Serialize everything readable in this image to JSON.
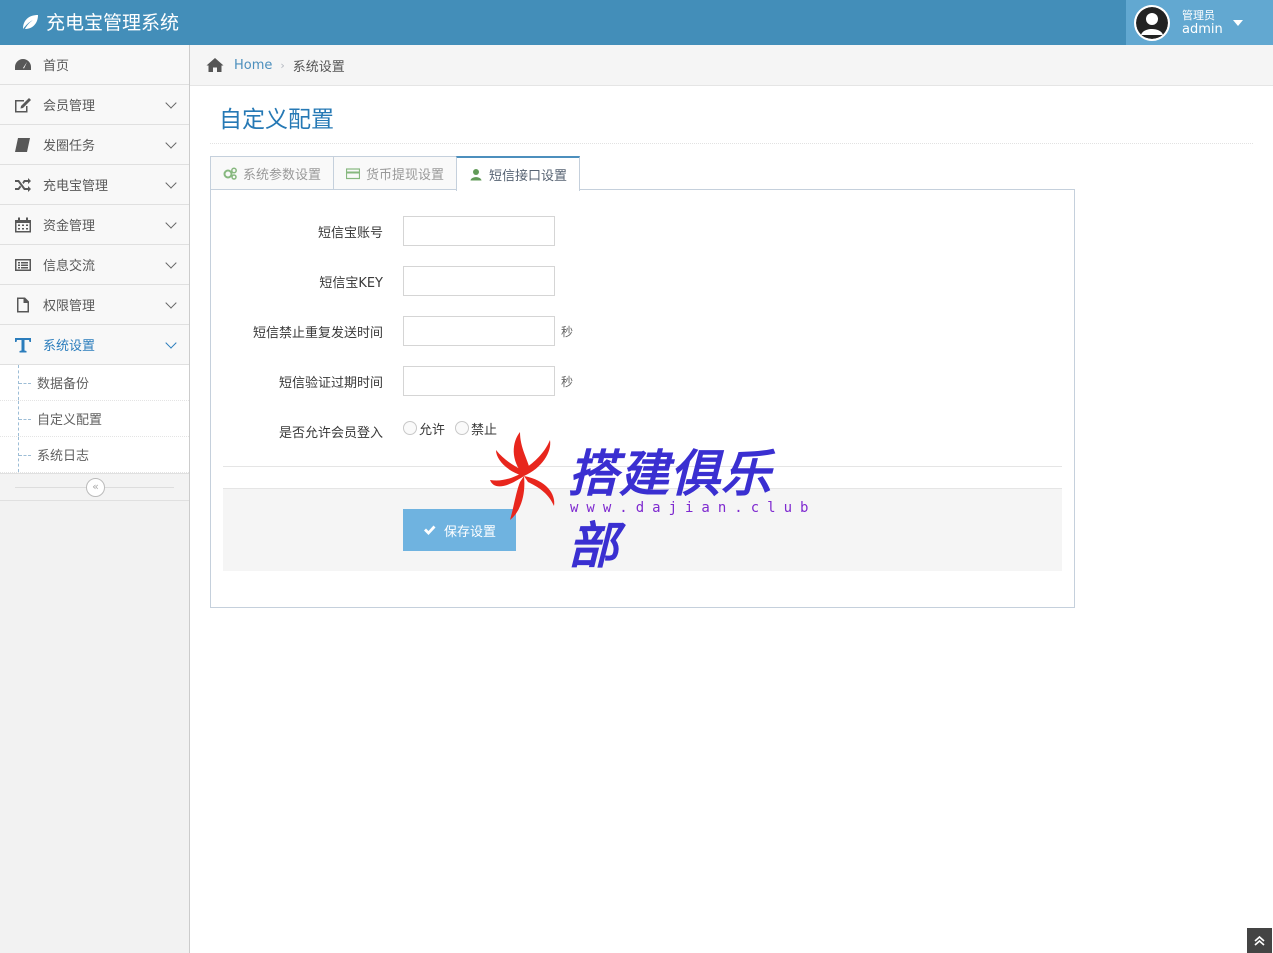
{
  "brand": {
    "title": "充电宝管理系统",
    "icon": "leaf-icon"
  },
  "user": {
    "role": "管理员",
    "name": "admin"
  },
  "sidebar": {
    "items": [
      {
        "label": "首页",
        "icon": "dashboard-icon"
      },
      {
        "label": "会员管理",
        "icon": "edit-icon"
      },
      {
        "label": "发圈任务",
        "icon": "book-icon"
      },
      {
        "label": "充电宝管理",
        "icon": "shuffle-icon"
      },
      {
        "label": "资金管理",
        "icon": "calendar-icon"
      },
      {
        "label": "信息交流",
        "icon": "list-icon"
      },
      {
        "label": "权限管理",
        "icon": "file-icon"
      },
      {
        "label": "系统设置",
        "icon": "text-icon"
      }
    ],
    "sub_items": [
      "数据备份",
      "自定义配置",
      "系统日志"
    ],
    "collapse_glyph": "«"
  },
  "breadcrumb": {
    "home": "Home",
    "separator": "›",
    "current": "系统设置"
  },
  "page": {
    "title": "自定义配置"
  },
  "tabs": [
    {
      "label": "系统参数设置",
      "icon": "cogs-icon",
      "active": false
    },
    {
      "label": "货币提现设置",
      "icon": "credit-card-icon",
      "active": false
    },
    {
      "label": "短信接口设置",
      "icon": "user-icon",
      "active": true
    }
  ],
  "form": {
    "fields": [
      {
        "label": "短信宝账号",
        "value": "",
        "suffix": ""
      },
      {
        "label": "短信宝KEY",
        "value": "",
        "suffix": ""
      },
      {
        "label": "短信禁止重复发送时间",
        "value": "",
        "suffix": "秒"
      },
      {
        "label": "短信验证过期时间",
        "value": "",
        "suffix": "秒"
      }
    ],
    "radio": {
      "label": "是否允许会员登入",
      "options": [
        "允许",
        "禁止"
      ]
    },
    "save_label": "保存设置"
  },
  "watermark": {
    "title": "搭建俱乐部",
    "url": "www.dajian.club"
  },
  "colors": {
    "topbar": "#438eb9",
    "accent": "#2679b5",
    "button": "#6fb3e0"
  }
}
